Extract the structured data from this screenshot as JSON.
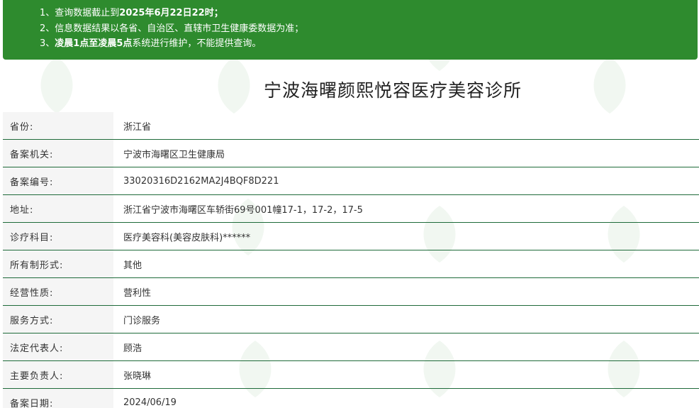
{
  "notice": {
    "line1_prefix": "1、查询数据截止到",
    "line1_bold": "2025年6月22日22时",
    "line1_suffix": "；",
    "line2": "2、信息数据结果以各省、自治区、直辖市卫生健康委数据为准；",
    "line3_prefix": "3、",
    "line3_bold": "凌晨1点至凌晨5点",
    "line3_suffix": "系统进行维护，不能提供查询。"
  },
  "title": "宁波海曙颜熙悦容医疗美容诊所",
  "rows": [
    {
      "label": "省份:",
      "value": "浙江省"
    },
    {
      "label": "备案机关:",
      "value": "宁波市海曙区卫生健康局"
    },
    {
      "label": "备案编号:",
      "value": "33020316D2162MA2J4BQF8D221"
    },
    {
      "label": "地址:",
      "value": "浙江省宁波市海曙区车轿街69号001幢17-1，17-2，17-5"
    },
    {
      "label": "诊疗科目:",
      "value": "医疗美容科(美容皮肤科)******"
    },
    {
      "label": "所有制形式:",
      "value": "其他"
    },
    {
      "label": "经营性质:",
      "value": "营利性"
    },
    {
      "label": "服务方式:",
      "value": "门诊服务"
    },
    {
      "label": "法定代表人:",
      "value": "顾浩"
    },
    {
      "label": "主要负责人:",
      "value": "张晓琳"
    },
    {
      "label": "备案日期:",
      "value": "2024/06/19"
    }
  ],
  "colors": {
    "notice_bg": "#2e8b2e",
    "row_border": "#1f6b3a",
    "label_bg": "#f5f5f5"
  }
}
